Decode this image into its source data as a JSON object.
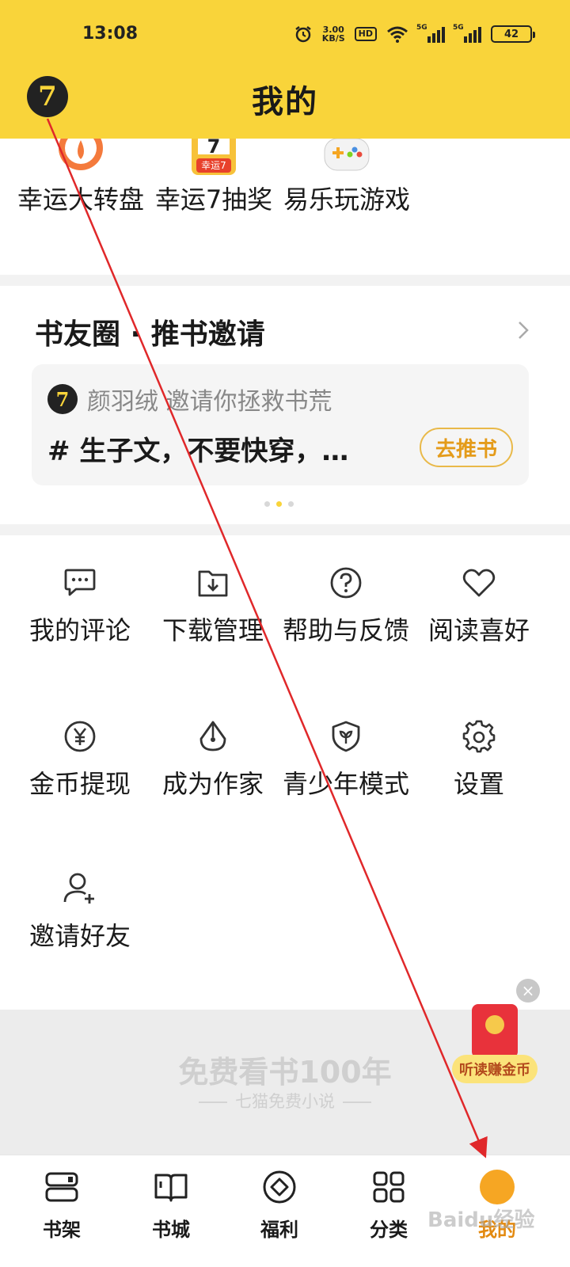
{
  "status_bar": {
    "time": "13:08",
    "speed_value": "3.00",
    "speed_unit": "KB/S",
    "hd_label": "HD",
    "sig1_label": "5G",
    "sig2_label": "5G",
    "battery": "42"
  },
  "header": {
    "title": "我的",
    "avatar_glyph": "7"
  },
  "top_apps": [
    {
      "label": "幸运大转盘",
      "icon": "wheel-icon"
    },
    {
      "label": "幸运7抽奖",
      "icon": "lucky7-icon",
      "badge": "幸运7"
    },
    {
      "label": "易乐玩游戏",
      "icon": "gamepad-icon"
    }
  ],
  "book_circle": {
    "title": "书友圈 · 推书邀请",
    "invite_text": "颜羽绒 邀请你拯救书荒",
    "content": "# 生子文，不要快穿，…",
    "button": "去推书",
    "avatar_glyph": "7"
  },
  "grid": [
    {
      "label": "我的评论",
      "icon": "comment-icon"
    },
    {
      "label": "下载管理",
      "icon": "download-folder-icon"
    },
    {
      "label": "帮助与反馈",
      "icon": "help-icon"
    },
    {
      "label": "阅读喜好",
      "icon": "heart-icon"
    },
    {
      "label": "金币提现",
      "icon": "coin-yen-icon"
    },
    {
      "label": "成为作家",
      "icon": "pen-nib-icon"
    },
    {
      "label": "青少年模式",
      "icon": "teen-shield-icon"
    },
    {
      "label": "设置",
      "icon": "gear-icon"
    },
    {
      "label": "邀请好友",
      "icon": "add-user-icon"
    }
  ],
  "banner": {
    "main": "免费看书100年",
    "sub": "七猫免费小说"
  },
  "float": {
    "close": "×",
    "pill": "听读赚金币"
  },
  "nav": [
    {
      "label": "书架",
      "icon": "bookshelf-icon"
    },
    {
      "label": "书城",
      "icon": "book-icon"
    },
    {
      "label": "福利",
      "icon": "welfare-icon"
    },
    {
      "label": "分类",
      "icon": "category-grid-icon"
    },
    {
      "label": "我的",
      "icon": "mine-icon",
      "active": true
    }
  ],
  "watermark": "Baidu经验",
  "colors": {
    "brand_yellow": "#f9d43a",
    "active_orange": "#e38a10",
    "annotation_red": "#e0282a"
  }
}
